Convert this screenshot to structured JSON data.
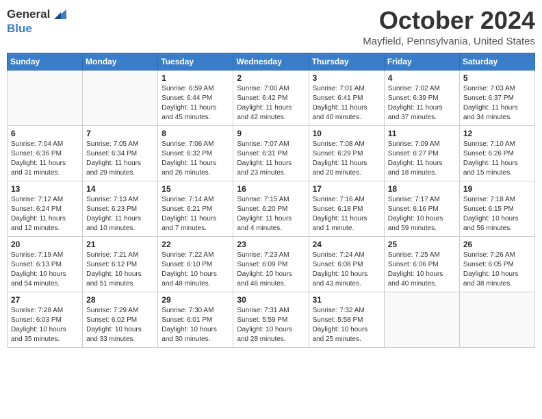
{
  "header": {
    "logo_general": "General",
    "logo_blue": "Blue",
    "month_title": "October 2024",
    "location": "Mayfield, Pennsylvania, United States"
  },
  "weekdays": [
    "Sunday",
    "Monday",
    "Tuesday",
    "Wednesday",
    "Thursday",
    "Friday",
    "Saturday"
  ],
  "weeks": [
    [
      {
        "day": "",
        "sunrise": "",
        "sunset": "",
        "daylight": ""
      },
      {
        "day": "",
        "sunrise": "",
        "sunset": "",
        "daylight": ""
      },
      {
        "day": "1",
        "sunrise": "Sunrise: 6:59 AM",
        "sunset": "Sunset: 6:44 PM",
        "daylight": "Daylight: 11 hours and 45 minutes."
      },
      {
        "day": "2",
        "sunrise": "Sunrise: 7:00 AM",
        "sunset": "Sunset: 6:42 PM",
        "daylight": "Daylight: 11 hours and 42 minutes."
      },
      {
        "day": "3",
        "sunrise": "Sunrise: 7:01 AM",
        "sunset": "Sunset: 6:41 PM",
        "daylight": "Daylight: 11 hours and 40 minutes."
      },
      {
        "day": "4",
        "sunrise": "Sunrise: 7:02 AM",
        "sunset": "Sunset: 6:39 PM",
        "daylight": "Daylight: 11 hours and 37 minutes."
      },
      {
        "day": "5",
        "sunrise": "Sunrise: 7:03 AM",
        "sunset": "Sunset: 6:37 PM",
        "daylight": "Daylight: 11 hours and 34 minutes."
      }
    ],
    [
      {
        "day": "6",
        "sunrise": "Sunrise: 7:04 AM",
        "sunset": "Sunset: 6:36 PM",
        "daylight": "Daylight: 11 hours and 31 minutes."
      },
      {
        "day": "7",
        "sunrise": "Sunrise: 7:05 AM",
        "sunset": "Sunset: 6:34 PM",
        "daylight": "Daylight: 11 hours and 29 minutes."
      },
      {
        "day": "8",
        "sunrise": "Sunrise: 7:06 AM",
        "sunset": "Sunset: 6:32 PM",
        "daylight": "Daylight: 11 hours and 26 minutes."
      },
      {
        "day": "9",
        "sunrise": "Sunrise: 7:07 AM",
        "sunset": "Sunset: 6:31 PM",
        "daylight": "Daylight: 11 hours and 23 minutes."
      },
      {
        "day": "10",
        "sunrise": "Sunrise: 7:08 AM",
        "sunset": "Sunset: 6:29 PM",
        "daylight": "Daylight: 11 hours and 20 minutes."
      },
      {
        "day": "11",
        "sunrise": "Sunrise: 7:09 AM",
        "sunset": "Sunset: 6:27 PM",
        "daylight": "Daylight: 11 hours and 18 minutes."
      },
      {
        "day": "12",
        "sunrise": "Sunrise: 7:10 AM",
        "sunset": "Sunset: 6:26 PM",
        "daylight": "Daylight: 11 hours and 15 minutes."
      }
    ],
    [
      {
        "day": "13",
        "sunrise": "Sunrise: 7:12 AM",
        "sunset": "Sunset: 6:24 PM",
        "daylight": "Daylight: 11 hours and 12 minutes."
      },
      {
        "day": "14",
        "sunrise": "Sunrise: 7:13 AM",
        "sunset": "Sunset: 6:23 PM",
        "daylight": "Daylight: 11 hours and 10 minutes."
      },
      {
        "day": "15",
        "sunrise": "Sunrise: 7:14 AM",
        "sunset": "Sunset: 6:21 PM",
        "daylight": "Daylight: 11 hours and 7 minutes."
      },
      {
        "day": "16",
        "sunrise": "Sunrise: 7:15 AM",
        "sunset": "Sunset: 6:20 PM",
        "daylight": "Daylight: 11 hours and 4 minutes."
      },
      {
        "day": "17",
        "sunrise": "Sunrise: 7:16 AM",
        "sunset": "Sunset: 6:18 PM",
        "daylight": "Daylight: 11 hours and 1 minute."
      },
      {
        "day": "18",
        "sunrise": "Sunrise: 7:17 AM",
        "sunset": "Sunset: 6:16 PM",
        "daylight": "Daylight: 10 hours and 59 minutes."
      },
      {
        "day": "19",
        "sunrise": "Sunrise: 7:18 AM",
        "sunset": "Sunset: 6:15 PM",
        "daylight": "Daylight: 10 hours and 56 minutes."
      }
    ],
    [
      {
        "day": "20",
        "sunrise": "Sunrise: 7:19 AM",
        "sunset": "Sunset: 6:13 PM",
        "daylight": "Daylight: 10 hours and 54 minutes."
      },
      {
        "day": "21",
        "sunrise": "Sunrise: 7:21 AM",
        "sunset": "Sunset: 6:12 PM",
        "daylight": "Daylight: 10 hours and 51 minutes."
      },
      {
        "day": "22",
        "sunrise": "Sunrise: 7:22 AM",
        "sunset": "Sunset: 6:10 PM",
        "daylight": "Daylight: 10 hours and 48 minutes."
      },
      {
        "day": "23",
        "sunrise": "Sunrise: 7:23 AM",
        "sunset": "Sunset: 6:09 PM",
        "daylight": "Daylight: 10 hours and 46 minutes."
      },
      {
        "day": "24",
        "sunrise": "Sunrise: 7:24 AM",
        "sunset": "Sunset: 6:08 PM",
        "daylight": "Daylight: 10 hours and 43 minutes."
      },
      {
        "day": "25",
        "sunrise": "Sunrise: 7:25 AM",
        "sunset": "Sunset: 6:06 PM",
        "daylight": "Daylight: 10 hours and 40 minutes."
      },
      {
        "day": "26",
        "sunrise": "Sunrise: 7:26 AM",
        "sunset": "Sunset: 6:05 PM",
        "daylight": "Daylight: 10 hours and 38 minutes."
      }
    ],
    [
      {
        "day": "27",
        "sunrise": "Sunrise: 7:28 AM",
        "sunset": "Sunset: 6:03 PM",
        "daylight": "Daylight: 10 hours and 35 minutes."
      },
      {
        "day": "28",
        "sunrise": "Sunrise: 7:29 AM",
        "sunset": "Sunset: 6:02 PM",
        "daylight": "Daylight: 10 hours and 33 minutes."
      },
      {
        "day": "29",
        "sunrise": "Sunrise: 7:30 AM",
        "sunset": "Sunset: 6:01 PM",
        "daylight": "Daylight: 10 hours and 30 minutes."
      },
      {
        "day": "30",
        "sunrise": "Sunrise: 7:31 AM",
        "sunset": "Sunset: 5:59 PM",
        "daylight": "Daylight: 10 hours and 28 minutes."
      },
      {
        "day": "31",
        "sunrise": "Sunrise: 7:32 AM",
        "sunset": "Sunset: 5:58 PM",
        "daylight": "Daylight: 10 hours and 25 minutes."
      },
      {
        "day": "",
        "sunrise": "",
        "sunset": "",
        "daylight": ""
      },
      {
        "day": "",
        "sunrise": "",
        "sunset": "",
        "daylight": ""
      }
    ]
  ]
}
